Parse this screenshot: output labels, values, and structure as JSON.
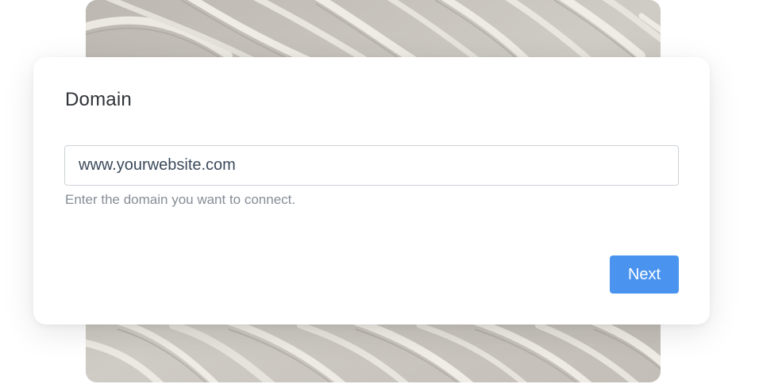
{
  "form": {
    "title": "Domain",
    "input_value": "www.yourwebsite.com",
    "helper": "Enter the domain you want to connect.",
    "next_label": "Next"
  },
  "colors": {
    "button_bg": "#4a94f0",
    "button_text": "#ffffff",
    "helper_text": "#868d96",
    "title_text": "#2f3338",
    "input_border": "#cfd3d8"
  }
}
